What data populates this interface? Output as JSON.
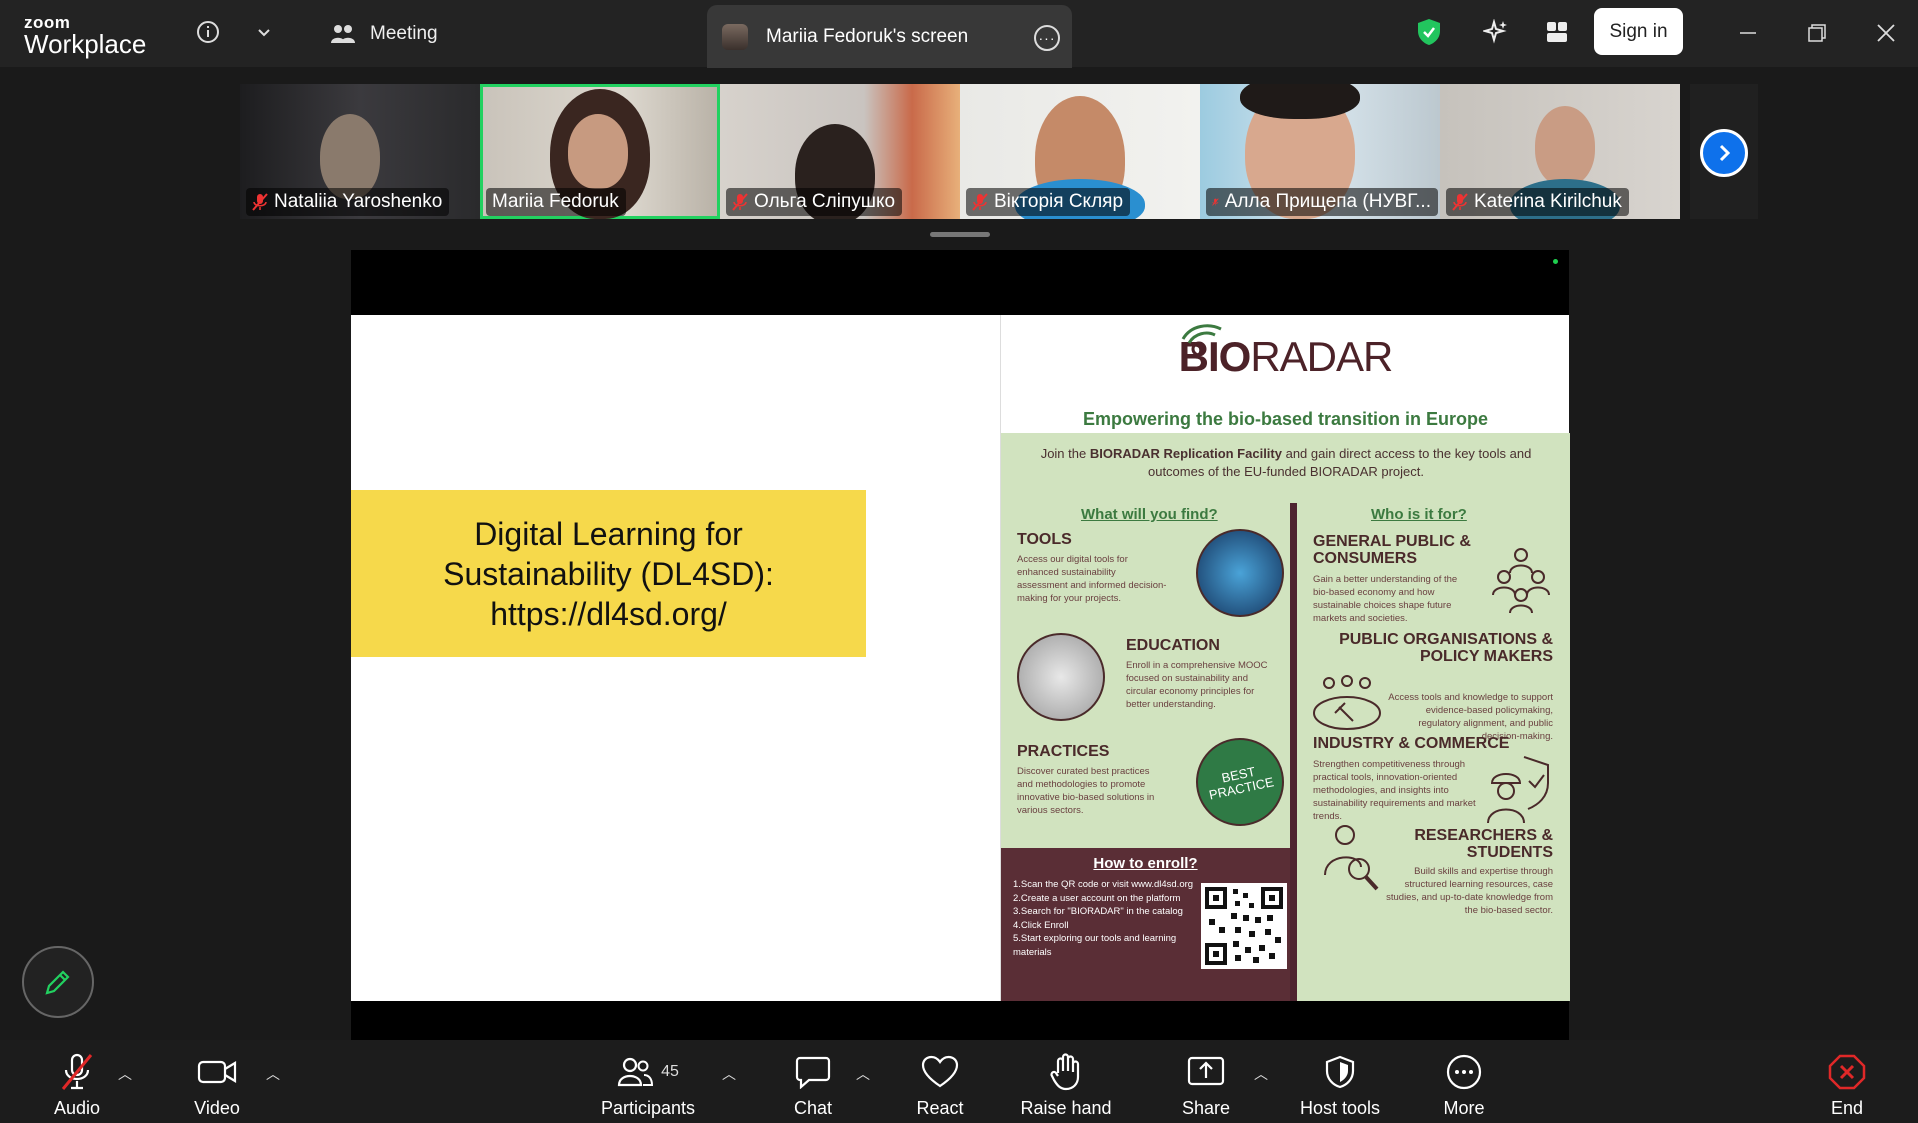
{
  "app": {
    "logo_small": "zoom",
    "logo_big": "Workplace"
  },
  "titlebar": {
    "meeting_label": "Meeting",
    "screen_tab_title": "Mariia Fedoruk's screen",
    "sign_in": "Sign in"
  },
  "participants": [
    {
      "name": "Nataliia Yaroshenko",
      "muted": true
    },
    {
      "name": "Mariia Fedoruk",
      "muted": false,
      "active": true
    },
    {
      "name": "Ольга Сліпушко",
      "muted": true
    },
    {
      "name": "Вікторія Скляр",
      "muted": true
    },
    {
      "name": "Алла Прищепа (НУВГ...",
      "muted": true
    },
    {
      "name": "Katerina Kirilchuk",
      "muted": true
    }
  ],
  "slide": {
    "yellow_line1": "Digital Learning for",
    "yellow_line2": "Sustainability (DL4SD):",
    "yellow_line3": "https://dl4sd.org/",
    "poster": {
      "brand_bold": "BIO",
      "brand_rest": "RADAR",
      "tagline": "Empowering the bio-based transition in Europe",
      "intro_a": "Join the ",
      "intro_b": "BIORADAR Replication Facility",
      "intro_c": " and gain direct access to the key tools and outcomes of the EU-funded BIORADAR project.",
      "left_head": "What will you find?",
      "right_head": "Who is it for?",
      "tools_title": "TOOLS",
      "tools_text": "Access our digital tools for enhanced sustainability assessment and informed decision-making for your projects.",
      "education_title": "EDUCATION",
      "education_text": "Enroll in a comprehensive MOOC focused on sustainability and circular economy principles for better understanding.",
      "practices_title": "PRACTICES",
      "practices_text": "Discover curated best practices and methodologies to promote innovative bio-based solutions in various sectors.",
      "best_practice": "BEST PRACTICE",
      "public_title": "GENERAL PUBLIC & CONSUMERS",
      "public_text": "Gain a better understanding of the bio-based economy and how sustainable choices shape future markets and societies.",
      "policy_title": "PUBLIC ORGANISATIONS & POLICY MAKERS",
      "policy_text": "Access tools and knowledge to support evidence-based policymaking, regulatory alignment, and public decision-making.",
      "industry_title": "INDUSTRY & COMMERCE",
      "industry_text": "Strengthen competitiveness through practical tools, innovation-oriented methodologies, and insights into sustainability requirements and market trends.",
      "research_title": "RESEARCHERS & STUDENTS",
      "research_text": "Build skills and expertise through structured learning resources, case studies, and up-to-date knowledge from the bio-based sector.",
      "enroll_head": "How to enroll?",
      "enroll_steps": [
        "1.Scan the QR code or visit www.dl4sd.org",
        "2.Create a user account on the platform",
        "3.Search for \"BIORADAR\" in the catalog",
        "4.Click Enroll",
        "5.Start exploring our tools and learning materials"
      ]
    }
  },
  "toolbar": {
    "audio": "Audio",
    "video": "Video",
    "participants": "Participants",
    "participants_count": "45",
    "chat": "Chat",
    "react": "React",
    "raise_hand": "Raise hand",
    "share": "Share",
    "host_tools": "Host tools",
    "more": "More",
    "end": "End"
  },
  "colors": {
    "accent_blue": "#0e71eb",
    "active_speaker": "#22d160",
    "end_red": "#e02828",
    "poster_green": "#3c7a40",
    "poster_maroon": "#5a2e36"
  }
}
